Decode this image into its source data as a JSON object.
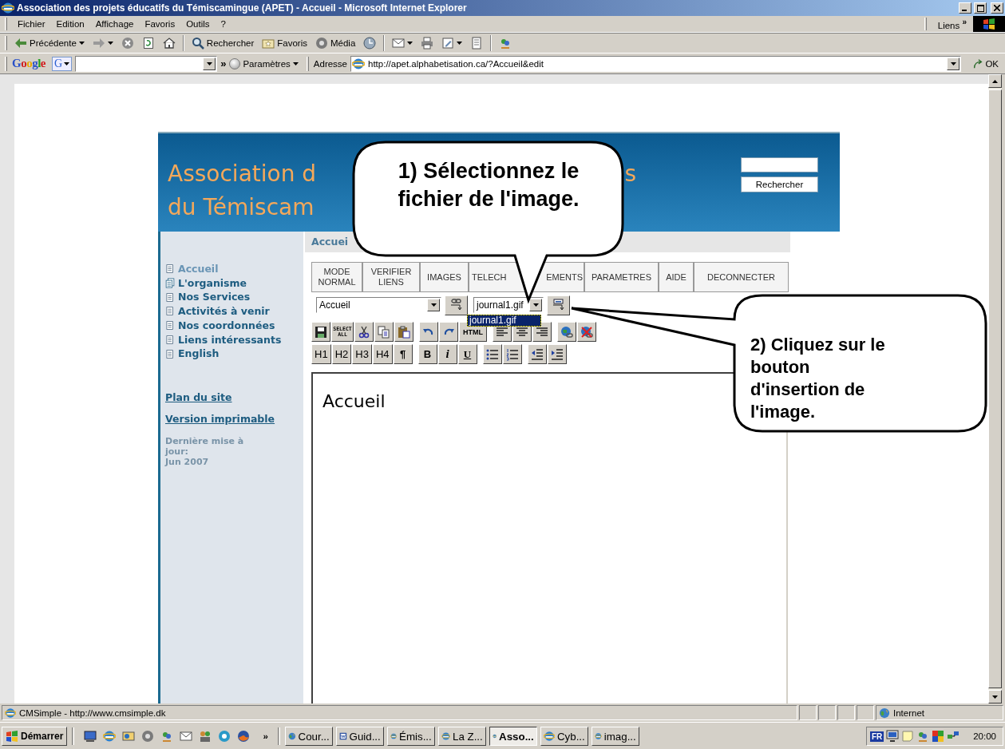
{
  "window": {
    "title": "Association des projets éducatifs du Témiscamingue (APET) - Accueil - Microsoft Internet Explorer"
  },
  "menu": [
    "Fichier",
    "Edition",
    "Affichage",
    "Favoris",
    "Outils",
    "?"
  ],
  "links_bar": {
    "label": "Liens",
    "chevron": "»"
  },
  "toolbar": [
    {
      "kind": "back",
      "label": "Précédente",
      "caret": true
    },
    {
      "kind": "forward",
      "caret": true
    },
    {
      "kind": "stop"
    },
    {
      "kind": "refresh"
    },
    {
      "kind": "home"
    },
    {
      "kind": "search",
      "label": "Rechercher",
      "separator_before": true
    },
    {
      "kind": "favorites",
      "label": "Favoris"
    },
    {
      "kind": "media",
      "label": "Média"
    },
    {
      "kind": "history"
    },
    {
      "kind": "mail",
      "caret": true,
      "separator_before": true
    },
    {
      "kind": "print"
    },
    {
      "kind": "edit",
      "caret": true
    },
    {
      "kind": "discuss"
    },
    {
      "kind": "messenger",
      "separator_before": true
    }
  ],
  "google_bar": {
    "logo": "Google",
    "engine_button": "G",
    "chevron": "»",
    "settings": "Paramètres"
  },
  "address": {
    "label": "Adresse",
    "url": "http://apet.alphabetisation.ca/?Accueil&edit",
    "go": "OK"
  },
  "site": {
    "title_line1_start": "Association d",
    "title_line1_end": "s",
    "title_line2": "du Témiscam",
    "search_button": "Rechercher",
    "nav": [
      {
        "label": "Accueil",
        "kind": "page",
        "selected": true
      },
      {
        "label": "L'organisme",
        "kind": "folder",
        "selected": false
      },
      {
        "label": "Nos Services",
        "kind": "page",
        "selected": false
      },
      {
        "label": "Activités à venir",
        "kind": "page",
        "selected": false
      },
      {
        "label": "Nos coordonnées",
        "kind": "page",
        "selected": false
      },
      {
        "label": "Liens intéressants",
        "kind": "page",
        "selected": false
      },
      {
        "label": "English",
        "kind": "page",
        "selected": false
      }
    ],
    "links": [
      "Plan du site",
      "Version imprimable"
    ],
    "updated_label": "Dernière mise à jour:",
    "updated_date": "Jun 2007",
    "heading": "Accuei"
  },
  "editor": {
    "tabs": [
      {
        "label": "MODE NORMAL"
      },
      {
        "label": "VERIFIER LIENS"
      },
      {
        "label": "IMAGES"
      },
      {
        "label": "TELECH",
        "label_end": "EMENTS"
      },
      {
        "label": "PARAMETRES"
      },
      {
        "label": "AIDE"
      },
      {
        "label": "DECONNECTER"
      }
    ],
    "page_select": "Accueil",
    "image_select": "journal1.gif",
    "dropdown": [
      {
        "label": "journal1.gif",
        "selected": true
      }
    ],
    "tools_row1": [
      {
        "kind": "save"
      },
      {
        "kind": "select-all",
        "label": "SELECT ALL"
      },
      {
        "kind": "cut"
      },
      {
        "kind": "copy"
      },
      {
        "kind": "paste"
      },
      {
        "kind": "undo"
      },
      {
        "kind": "redo"
      },
      {
        "kind": "html",
        "label": "HTML"
      },
      {
        "kind": "align-left"
      },
      {
        "kind": "align-center"
      },
      {
        "kind": "align-right"
      },
      {
        "kind": "link"
      },
      {
        "kind": "unlink"
      }
    ],
    "tools_row2": [
      {
        "kind": "heading",
        "label": "H1"
      },
      {
        "kind": "heading",
        "label": "H2"
      },
      {
        "kind": "heading",
        "label": "H3"
      },
      {
        "kind": "heading",
        "label": "H4"
      },
      {
        "kind": "paragraph",
        "label": "¶"
      },
      {
        "kind": "bold",
        "label": "B"
      },
      {
        "kind": "italic",
        "label": "i"
      },
      {
        "kind": "underline",
        "label": "U"
      },
      {
        "kind": "bullets"
      },
      {
        "kind": "numbers"
      },
      {
        "kind": "outdent"
      },
      {
        "kind": "indent"
      }
    ],
    "content": "Accueil"
  },
  "callouts": [
    {
      "text": "1) Sélectionnez le fichier de l'image."
    },
    {
      "text": "2) Cliquez sur le bouton d'insertion de l'image."
    }
  ],
  "status_bar": {
    "text": "CMSimple - http://www.cmsimple.dk",
    "zone": "Internet"
  },
  "taskbar": {
    "start": "Démarrer",
    "quick_launch": [
      {
        "kind": "desktop"
      },
      {
        "kind": "browser"
      },
      {
        "kind": "outlook"
      },
      {
        "kind": "media"
      },
      {
        "kind": "messenger"
      },
      {
        "kind": "mail"
      },
      {
        "kind": "people"
      },
      {
        "kind": "chat"
      },
      {
        "kind": "firefox"
      }
    ],
    "chevron": "»",
    "tasks": [
      {
        "kind": "globe",
        "label": "Cour...",
        "selected": false
      },
      {
        "kind": "word",
        "label": "Guid...",
        "selected": false
      },
      {
        "kind": "browser",
        "label": "Émis...",
        "selected": false
      },
      {
        "kind": "browser",
        "label": "La Z...",
        "selected": false
      },
      {
        "kind": "browser",
        "label": "Asso...",
        "selected": true
      },
      {
        "kind": "browser",
        "label": "Cyb...",
        "selected": false
      },
      {
        "kind": "browser",
        "label": "imag...",
        "selected": false
      }
    ],
    "language": "FR",
    "tray_icons": [
      {
        "kind": "monitor"
      },
      {
        "kind": "note"
      },
      {
        "kind": "messenger"
      },
      {
        "kind": "palette"
      },
      {
        "kind": "network"
      }
    ],
    "clock": "20:00"
  }
}
